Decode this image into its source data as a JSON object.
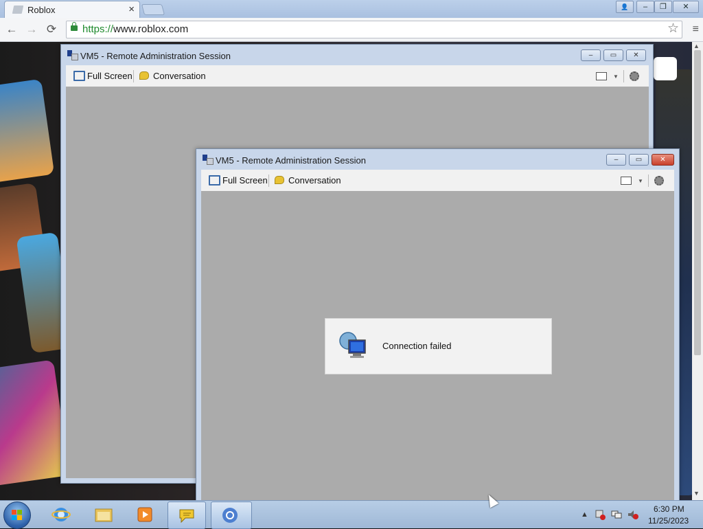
{
  "browser": {
    "tab_title": "Roblox",
    "tab_close": "×",
    "url_scheme": "https://",
    "url_host": "www.roblox.com",
    "star": "☆",
    "menu": "≡",
    "back": "←",
    "forward": "→",
    "reload": "⟳",
    "user": "👤",
    "minimize": "–",
    "restore": "❐",
    "close": "✕"
  },
  "sessions": [
    {
      "title": "VM5 - Remote Administration Session",
      "full_screen": "Full Screen",
      "conversation": "Conversation"
    },
    {
      "title": "VM5 - Remote Administration Session",
      "full_screen": "Full Screen",
      "conversation": "Conversation",
      "status": "Connection failed"
    }
  ],
  "caption": {
    "minimize": "–",
    "maximize": "▭",
    "close": "✕"
  },
  "taskbar": {
    "time": "6:30 PM",
    "date": "11/25/2023",
    "tray_up": "▲"
  },
  "colors": {
    "chrome_frame": "#bcd0ea",
    "url_scheme_green": "#1f8a2d",
    "viewport_gray": "#ababab",
    "taskbar": "#b7cde6"
  }
}
